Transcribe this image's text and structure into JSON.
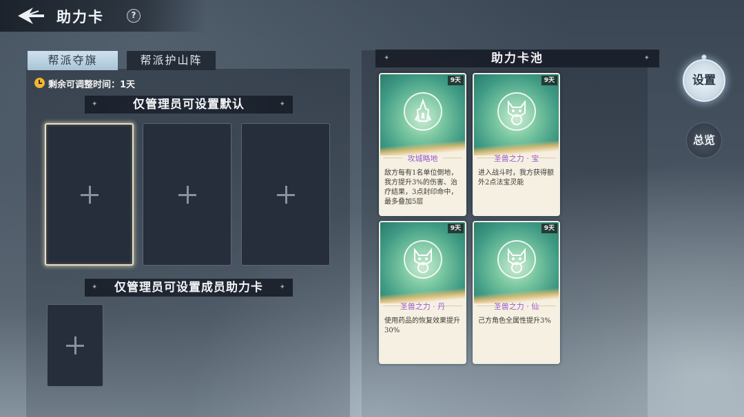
{
  "header": {
    "title": "助力卡",
    "help_label": "?"
  },
  "tabs": [
    {
      "label": "帮派夺旗",
      "active": true
    },
    {
      "label": "帮派护山阵",
      "active": false
    }
  ],
  "timer": {
    "text": "剩余可调整时间：1天"
  },
  "default_section": {
    "title": "仅管理员可设置默认",
    "slots": [
      {
        "state": "selected"
      },
      {
        "state": "empty"
      },
      {
        "state": "empty"
      }
    ]
  },
  "member_section": {
    "title": "仅管理员可设置成员助力卡"
  },
  "card_pool": {
    "title": "助力卡池",
    "cards": [
      {
        "name": "攻城略地",
        "days": "9天",
        "emblem": "tower-icon",
        "desc": "敌方每有1名单位倒地，我方提升3%的伤害、治疗结果，3点封印命中，最多叠加5层"
      },
      {
        "name": "圣兽之力 · 宝",
        "days": "9天",
        "emblem": "beast-icon",
        "desc": "进入战斗时，我方获得额外2点法宝灵能"
      },
      {
        "name": "圣兽之力 · 丹",
        "days": "9天",
        "emblem": "beast-icon",
        "desc": "使用药品的恢复效果提升30%"
      },
      {
        "name": "圣兽之力 · 仙",
        "days": "9天",
        "emblem": "beast-icon",
        "desc": "己方角色全属性提升3%"
      }
    ]
  },
  "side_buttons": {
    "settings": "设置",
    "overview": "总览"
  },
  "colors": {
    "card_name": "#9a5cc8",
    "card_art": "#3f9a84",
    "timer_icon": "#f1b632",
    "active_tab": "#cfe1ee"
  }
}
